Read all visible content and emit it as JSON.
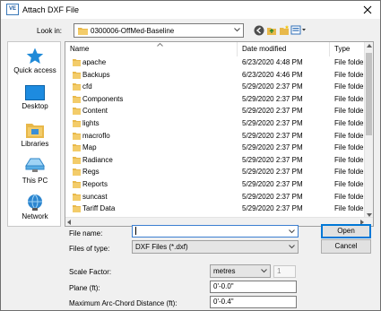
{
  "window": {
    "icon_text": "VE",
    "title": "Attach DXF File"
  },
  "lookin": {
    "label": "Look in:",
    "value": "0300006-OffMed-Baseline"
  },
  "places": [
    {
      "label": "Quick access",
      "icon": "star-icon"
    },
    {
      "label": "Desktop",
      "icon": "desktop-icon"
    },
    {
      "label": "Libraries",
      "icon": "libraries-icon"
    },
    {
      "label": "This PC",
      "icon": "computer-icon"
    },
    {
      "label": "Network",
      "icon": "network-icon"
    }
  ],
  "columns": {
    "name": "Name",
    "date": "Date modified",
    "type": "Type"
  },
  "files": [
    {
      "name": "apache",
      "date": "6/23/2020 4:48 PM",
      "type": "File folder"
    },
    {
      "name": "Backups",
      "date": "6/23/2020 4:46 PM",
      "type": "File folder"
    },
    {
      "name": "cfd",
      "date": "5/29/2020 2:37 PM",
      "type": "File folder"
    },
    {
      "name": "Components",
      "date": "5/29/2020 2:37 PM",
      "type": "File folder"
    },
    {
      "name": "Content",
      "date": "5/29/2020 2:37 PM",
      "type": "File folder"
    },
    {
      "name": "lights",
      "date": "5/29/2020 2:37 PM",
      "type": "File folder"
    },
    {
      "name": "macroflo",
      "date": "5/29/2020 2:37 PM",
      "type": "File folder"
    },
    {
      "name": "Map",
      "date": "5/29/2020 2:37 PM",
      "type": "File folder"
    },
    {
      "name": "Radiance",
      "date": "5/29/2020 2:37 PM",
      "type": "File folder"
    },
    {
      "name": "Regs",
      "date": "5/29/2020 2:37 PM",
      "type": "File folder"
    },
    {
      "name": "Reports",
      "date": "5/29/2020 2:37 PM",
      "type": "File folder"
    },
    {
      "name": "suncast",
      "date": "5/29/2020 2:37 PM",
      "type": "File folder"
    },
    {
      "name": "Tariff Data",
      "date": "5/29/2020 2:37 PM",
      "type": "File folder"
    }
  ],
  "filename": {
    "label": "File name:",
    "value": ""
  },
  "filetype": {
    "label": "Files of type:",
    "value": "DXF Files (*.dxf)"
  },
  "buttons": {
    "open": "Open",
    "cancel": "Cancel"
  },
  "scale": {
    "label": "Scale Factor:",
    "unit": "metres",
    "value": "1"
  },
  "plane": {
    "label": "Plane (ft):",
    "value": "0'-0.0\""
  },
  "arc": {
    "label": "Maximum Arc-Chord Distance (ft):",
    "value": "0'-0.4\""
  },
  "colors": {
    "accent": "#0078d7",
    "folder": "#e8b84a",
    "dialog_bg": "#f0f0f0"
  }
}
